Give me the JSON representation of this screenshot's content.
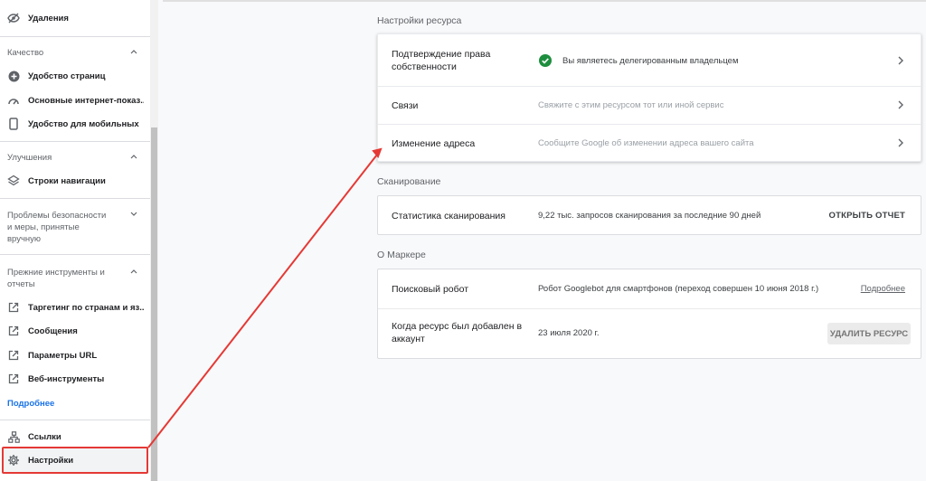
{
  "sidebar": {
    "item_removals": {
      "label": "Удаления",
      "icon": "eye-off-icon"
    },
    "quality": {
      "header": "Качество",
      "items": [
        {
          "label": "Удобство страниц",
          "icon": "plus-circle-icon"
        },
        {
          "label": "Основные интернет-показ...",
          "icon": "speedometer-icon"
        },
        {
          "label": "Удобство для мобильных",
          "icon": "smartphone-icon"
        }
      ]
    },
    "enhancements": {
      "header": "Улучшения",
      "items": [
        {
          "label": "Строки навигации",
          "icon": "layers-icon"
        }
      ]
    },
    "security": {
      "header": "Проблемы безопасности и меры, принятые вручную"
    },
    "legacy": {
      "header": "Прежние инструменты и отчеты",
      "items": [
        {
          "label": "Таргетинг по странам и яз...",
          "icon": "external-link-icon"
        },
        {
          "label": "Сообщения",
          "icon": "external-link-icon"
        },
        {
          "label": "Параметры URL",
          "icon": "external-link-icon"
        },
        {
          "label": "Веб-инструменты",
          "icon": "external-link-icon"
        }
      ],
      "more": "Подробнее"
    },
    "links": {
      "label": "Ссылки",
      "icon": "network-icon"
    },
    "settings": {
      "label": "Настройки",
      "icon": "gear-icon"
    }
  },
  "main": {
    "property_settings": {
      "title": "Настройки ресурса",
      "rows": [
        {
          "label": "Подтверждение права собственности",
          "desc": "Вы являетесь делегированным владельцем"
        },
        {
          "label": "Связи",
          "desc": "Свяжите с этим ресурсом тот или иной сервис"
        },
        {
          "label": "Изменение адреса",
          "desc": "Сообщите Google об изменении адреса вашего сайта"
        }
      ]
    },
    "crawling": {
      "title": "Сканирование",
      "label": "Статистика сканирования",
      "desc": "9,22 тыс. запросов сканирования за последние 90 дней",
      "button": "ОТКРЫТЬ ОТЧЕТ"
    },
    "about": {
      "title": "О Маркере",
      "crawler_label": "Поисковый робот",
      "crawler_desc": "Робот Googlebot для смартфонов (переход совершен 10 июня 2018 г.)",
      "crawler_link": "Подробнее",
      "added_label": "Когда ресурс был добавлен в аккаунт",
      "added_desc": "23 июля 2020 г.",
      "remove_button": "УДАЛИТЬ РЕСУРС"
    }
  },
  "colors": {
    "annotation_red": "#e53935",
    "verified_green": "#1e8e3e",
    "link_blue": "#1a73e8"
  }
}
